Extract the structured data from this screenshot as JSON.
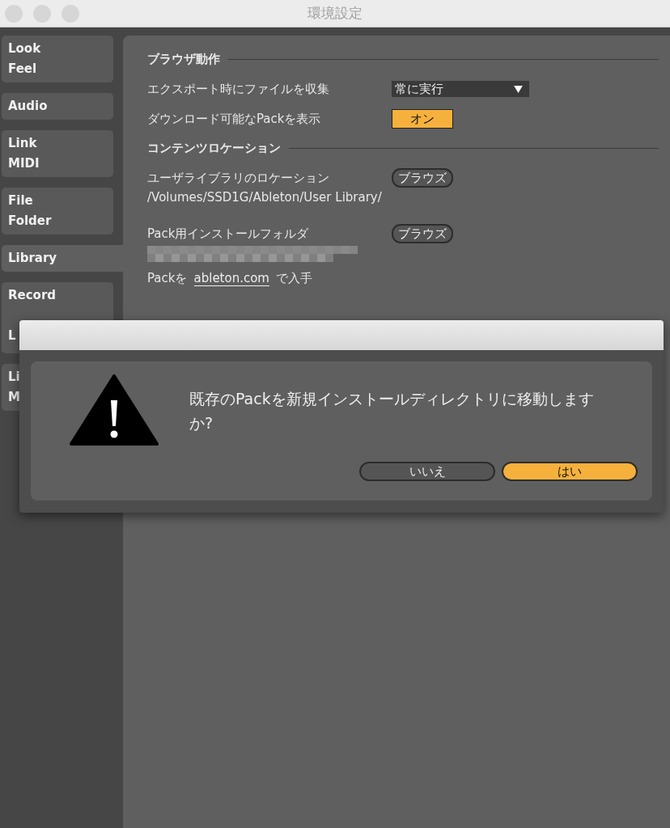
{
  "window": {
    "title": "環境設定"
  },
  "sidebar": {
    "items": [
      {
        "lines": [
          "Look",
          "Feel"
        ],
        "selected": false
      },
      {
        "lines": [
          "Audio"
        ],
        "selected": false
      },
      {
        "lines": [
          "Link",
          "MIDI"
        ],
        "selected": false
      },
      {
        "lines": [
          "File",
          "Folder"
        ],
        "selected": false
      },
      {
        "lines": [
          "Library"
        ],
        "selected": true
      },
      {
        "lines": [
          "Record",
          "L"
        ],
        "selected": false
      },
      {
        "lines": [
          "Li",
          "M"
        ],
        "selected": false
      }
    ]
  },
  "sections": [
    {
      "title": "ブラウザ動作",
      "rows": [
        {
          "kind": "dropdown",
          "label": "エクスポート時にファイルを収集",
          "value": "常に実行"
        },
        {
          "kind": "toggle",
          "label": "ダウンロード可能なPackを表示",
          "value": "オン",
          "on": true
        }
      ]
    },
    {
      "title": "コンテンツロケーション",
      "rows": [
        {
          "kind": "browse",
          "label": "ユーザライブラリのロケーション",
          "button": "ブラウズ",
          "path": "/Volumes/SSD1G/Ableton/User Library/"
        },
        {
          "kind": "browse",
          "label": "Pack用インストールフォルダ",
          "button": "ブラウズ",
          "redacted": true
        },
        {
          "kind": "link",
          "before": "Packを",
          "link": "ableton.com",
          "after": "で入手"
        }
      ]
    }
  ],
  "dialog": {
    "message": "既存のPackを新規インストールディレクトリに移動しますか?",
    "buttons": [
      {
        "label": "いいえ",
        "default": false
      },
      {
        "label": "はい",
        "default": true
      }
    ]
  }
}
